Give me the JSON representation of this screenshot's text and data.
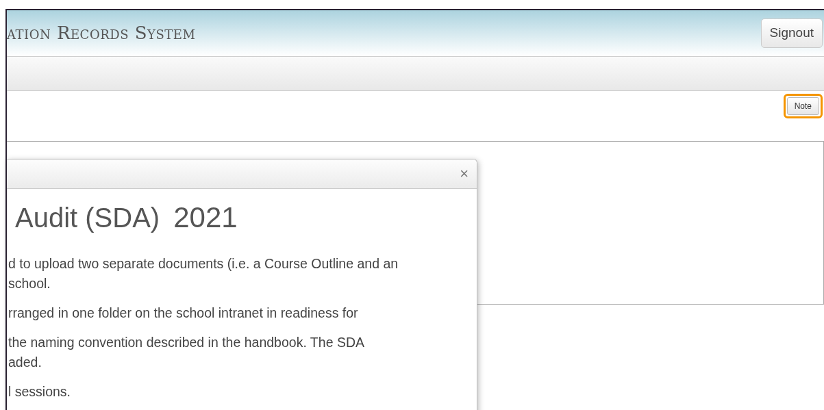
{
  "header": {
    "title": "ation Records System",
    "signout": "Signout"
  },
  "toolbar": {
    "note_button": {
      "label": "Note",
      "highlighted": true
    }
  },
  "modal": {
    "title": "Audit (SDA)",
    "year": "2021",
    "close": "×",
    "paragraphs": [
      {
        "lines": [
          "d to upload two separate documents (i.e. a Course Outline and an",
          "school."
        ]
      },
      {
        "lines": [
          "rranged in one folder on the school intranet in readiness for"
        ]
      },
      {
        "lines": [
          "the naming convention described in the handbook. The SDA",
          "aded."
        ]
      },
      {
        "lines": [
          "l sessions."
        ]
      }
    ]
  }
}
